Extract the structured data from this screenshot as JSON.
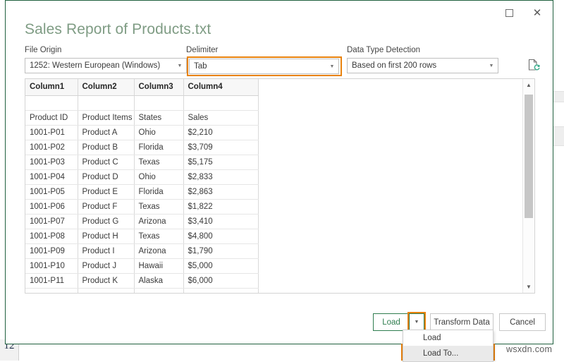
{
  "window": {
    "maximize_label": "Maximize",
    "close_label": "Close",
    "close_glyph": "✕"
  },
  "dialog": {
    "title": "Sales Report of Products.txt",
    "accent_orange": "#E8820D",
    "accent_green": "#2F7D4F",
    "title_color": "#7F9C84"
  },
  "fields": {
    "file_origin": {
      "label": "File Origin",
      "value": "1252: Western European (Windows)",
      "arrow": "▼"
    },
    "delimiter": {
      "label": "Delimiter",
      "value": "Tab",
      "arrow": "▼",
      "highlighted": true
    },
    "data_type_detection": {
      "label": "Data Type Detection",
      "value": "Based on first 200 rows",
      "arrow": "▼"
    },
    "refresh_icon": "file-refresh-icon"
  },
  "preview": {
    "headers": [
      "Column1",
      "Column2",
      "Column3",
      "Column4"
    ],
    "rows": [
      [
        "",
        "",
        "",
        ""
      ],
      [
        "Product ID",
        "Product Items",
        "States",
        "Sales"
      ],
      [
        "1001-P01",
        "Product A",
        "Ohio",
        "$2,210"
      ],
      [
        "1001-P02",
        "Product B",
        "Florida",
        "$3,709"
      ],
      [
        "1001-P03",
        "Product C",
        "Texas",
        "$5,175"
      ],
      [
        "1001-P04",
        "Product D",
        "Ohio",
        "$2,833"
      ],
      [
        "1001-P05",
        "Product E",
        "Florida",
        "$2,863"
      ],
      [
        "1001-P06",
        "Product F",
        "Texas",
        "$1,822"
      ],
      [
        "1001-P07",
        "Product G",
        "Arizona",
        "$3,410"
      ],
      [
        "1001-P08",
        "Product H",
        "Texas",
        "$4,800"
      ],
      [
        "1001-P09",
        "Product I",
        "Arizona",
        "$1,790"
      ],
      [
        "1001-P10",
        "Product J",
        "Hawaii",
        "$5,000"
      ],
      [
        "1001-P11",
        "Product K",
        "Alaska",
        "$6,000"
      ],
      [
        "",
        "",
        "",
        ""
      ]
    ],
    "scrollbar": {
      "up_arrow": "▲",
      "down_arrow": "▼"
    }
  },
  "footer": {
    "load_label": "Load",
    "load_arrow": "▼",
    "transform_label": "Transform Data",
    "cancel_label": "Cancel"
  },
  "load_menu": {
    "items": [
      {
        "label": "Load",
        "selected": false
      },
      {
        "label": "Load To...",
        "selected": true
      }
    ]
  },
  "background": {
    "row_number": "12",
    "watermark": "wsxdn.com"
  }
}
